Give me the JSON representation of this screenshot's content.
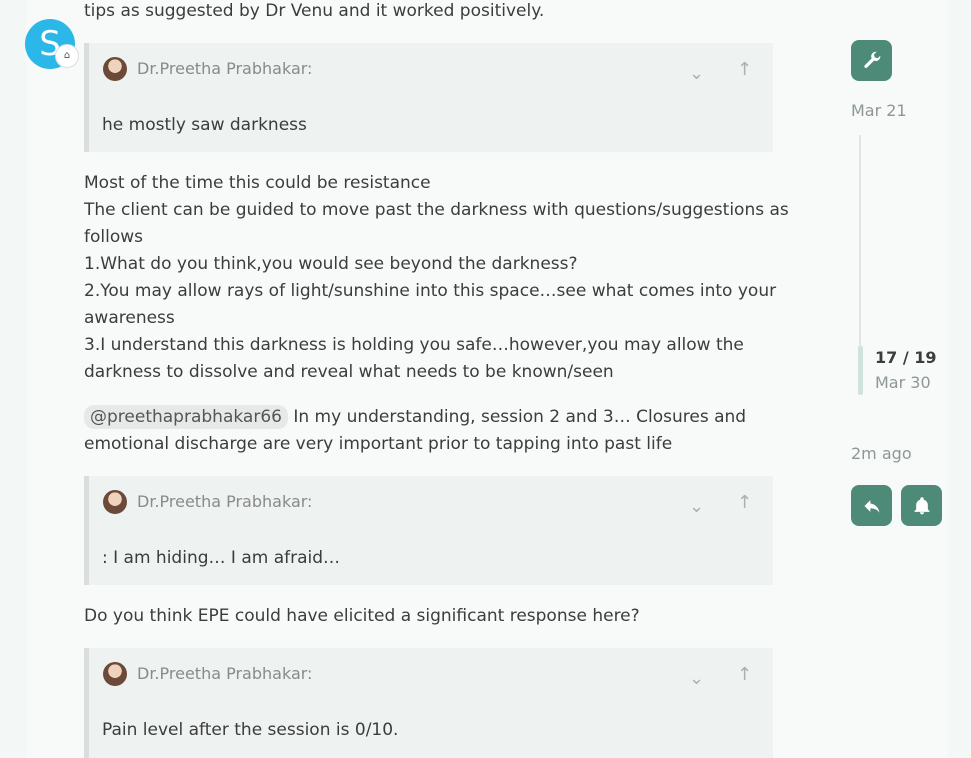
{
  "post": {
    "top_line": "tips as suggested by Dr Venu and it worked positively.",
    "avatar_letter": "S",
    "quotes": [
      {
        "author": "Dr.Preetha Prabhakar:",
        "text": "he mostly saw darkness"
      },
      {
        "author": "Dr.Preetha Prabhakar:",
        "text": ": I am hiding… I am afraid…"
      },
      {
        "author": "Dr.Preetha Prabhakar:",
        "text": "Pain level after the session is 0/10."
      }
    ],
    "paragraph_lines": [
      "Most of the time this could be resistance",
      "The client can be guided to move past the darkness with questions/suggestions as",
      "follows",
      "1.What do you think,you would see beyond the darkness?",
      "2.You may allow rays of light/sunshine into this space…see what comes into your",
      "awareness",
      "3.I understand this darkness is holding you safe…however,you may allow the",
      "darkness to dissolve and reveal what needs to be known/seen"
    ],
    "mention": "@preethaprabhakar66",
    "mention_line1_rest": " In my understanding, session 2 and 3… Closures and",
    "mention_line2": "emotional discharge are very important prior to tapping into past life",
    "question": "Do you think EPE could have elicited a significant response here?"
  },
  "timeline": {
    "start_date": "Mar 21",
    "position": "17 / 19",
    "position_date": "Mar 30",
    "end_label": "2m ago"
  },
  "icons": {
    "wrench": "wrench-icon",
    "reply": "reply-icon",
    "bell": "bell-icon",
    "expand": "chevron-down-icon",
    "jump": "arrow-up-icon"
  },
  "colors": {
    "accent": "#4e8a78",
    "avatar": "#2bb8e9"
  }
}
